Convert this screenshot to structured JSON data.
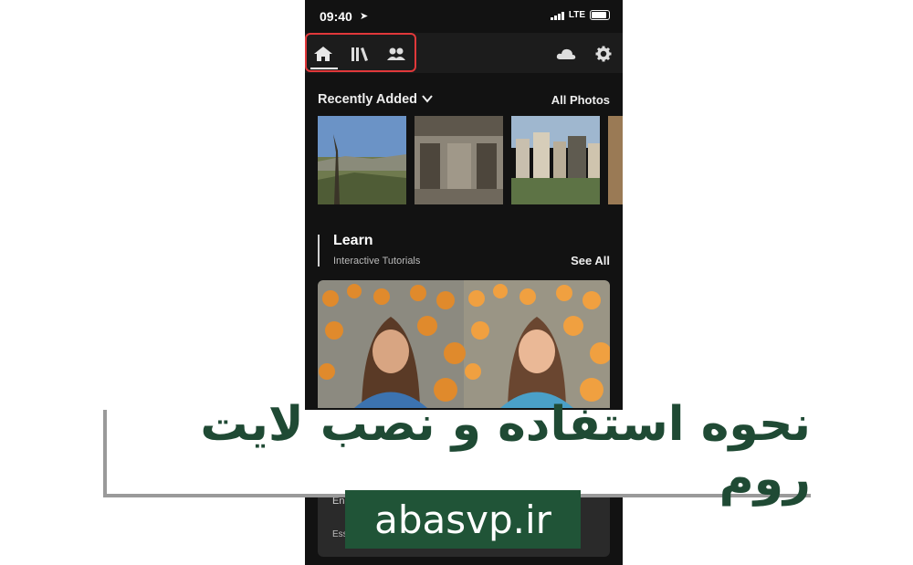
{
  "status_bar": {
    "time": "09:40",
    "network": "LTE"
  },
  "navigation": {
    "tabs": [
      {
        "icon": "home-icon"
      },
      {
        "icon": "library-icon"
      },
      {
        "icon": "people-icon"
      }
    ],
    "right_icons": [
      "cloud-icon",
      "gear-icon"
    ],
    "highlight_color": "#e0383a"
  },
  "recent": {
    "title": "Recently Added",
    "all_label": "All Photos",
    "thumbnails": [
      "landscape",
      "building-facade",
      "city-skyline",
      "partial"
    ]
  },
  "learn": {
    "title": "Learn",
    "subtitle": "Interactive Tutorials",
    "see_all": "See All",
    "card2_line1": "En",
    "card2_line2": "Ess"
  },
  "overlay": {
    "title": "نحوه استفاده و نصب لایت روم",
    "logo": "abasvp.ir",
    "brand_color": "#205437"
  }
}
